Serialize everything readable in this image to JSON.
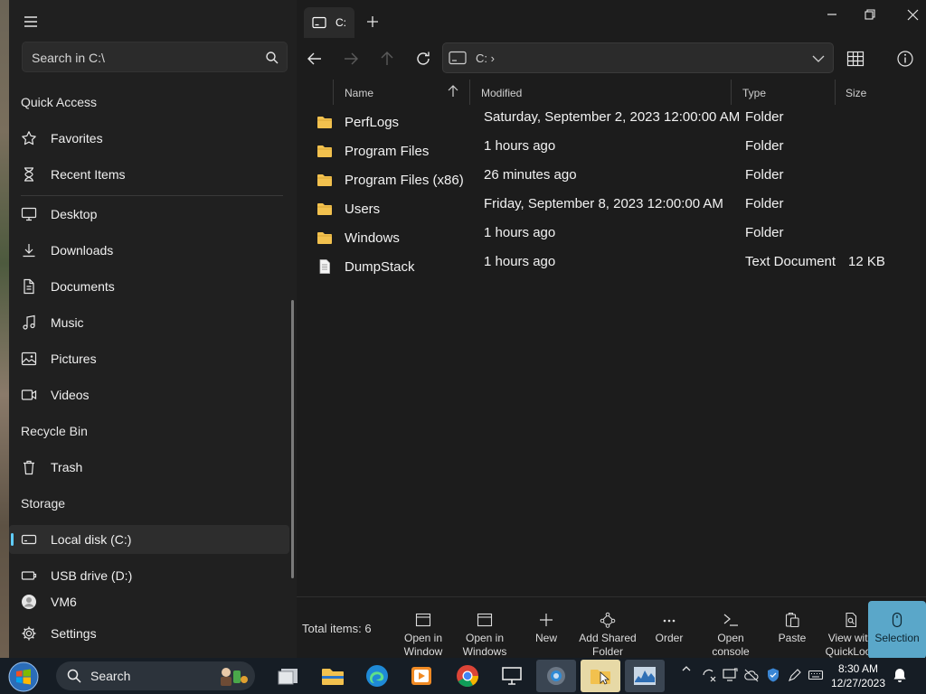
{
  "window": {
    "tab_label": "C:",
    "search_placeholder": "Search in C:\\",
    "address_path": "C: ›"
  },
  "sidebar": {
    "quick_access_title": "Quick Access",
    "quick_access": [
      {
        "label": "Favorites",
        "icon": "star-icon"
      },
      {
        "label": "Recent Items",
        "icon": "hourglass-icon"
      }
    ],
    "libraries": [
      {
        "label": "Desktop",
        "icon": "monitor-icon"
      },
      {
        "label": "Downloads",
        "icon": "download-icon"
      },
      {
        "label": "Documents",
        "icon": "document-icon"
      },
      {
        "label": "Music",
        "icon": "music-icon"
      },
      {
        "label": "Pictures",
        "icon": "image-icon"
      },
      {
        "label": "Videos",
        "icon": "video-icon"
      }
    ],
    "recycle_title": "Recycle Bin",
    "trash_label": "Trash",
    "storage_title": "Storage",
    "drives": [
      {
        "label": "Local disk (C:)",
        "icon": "drive-icon",
        "selected": true
      },
      {
        "label": "USB drive (D:)",
        "icon": "usb-drive-icon",
        "selected": false
      }
    ],
    "vm_label": "VM6",
    "settings_label": "Settings"
  },
  "columns": {
    "name": "Name",
    "modified": "Modified",
    "type": "Type",
    "size": "Size"
  },
  "files": [
    {
      "name": "PerfLogs",
      "modified": "Saturday, September 2, 2023 12:00:00 AM",
      "type": "Folder",
      "size": "",
      "icon": "folder-icon"
    },
    {
      "name": "Program Files",
      "modified": "1 hours ago",
      "type": "Folder",
      "size": "",
      "icon": "folder-icon"
    },
    {
      "name": "Program Files (x86)",
      "modified": "26 minutes ago",
      "type": "Folder",
      "size": "",
      "icon": "folder-icon"
    },
    {
      "name": "Users",
      "modified": "Friday, September 8, 2023 12:00:00 AM",
      "type": "Folder",
      "size": "",
      "icon": "folder-icon"
    },
    {
      "name": "Windows",
      "modified": "1 hours ago",
      "type": "Folder",
      "size": "",
      "icon": "folder-icon"
    },
    {
      "name": "DumpStack",
      "modified": "1 hours ago",
      "type": "Text Document",
      "size": "12 KB",
      "icon": "text-file-icon"
    }
  ],
  "commandbar": {
    "total_items": "Total items: 6",
    "commands": [
      {
        "label": "Open in Window",
        "icon": "window-icon"
      },
      {
        "label": "Open in Windows",
        "icon": "window-icon"
      },
      {
        "label": "New",
        "icon": "plus-icon"
      },
      {
        "label": "Add Shared Folder",
        "icon": "share-icon"
      },
      {
        "label": "Order",
        "icon": "more-icon"
      },
      {
        "label": "Open console",
        "icon": "console-icon"
      },
      {
        "label": "Paste",
        "icon": "paste-icon"
      },
      {
        "label": "View with QuickLook",
        "icon": "quicklook-icon"
      },
      {
        "label": "Selection",
        "icon": "mouse-icon"
      }
    ]
  },
  "taskbar": {
    "search_label": "Search",
    "time": "8:30 AM",
    "date": "12/27/2023"
  },
  "colors": {
    "accent": "#60cdff",
    "folder": "#f2c14e",
    "selection_button": "#5aa7c9",
    "taskbar": "#161d25"
  }
}
